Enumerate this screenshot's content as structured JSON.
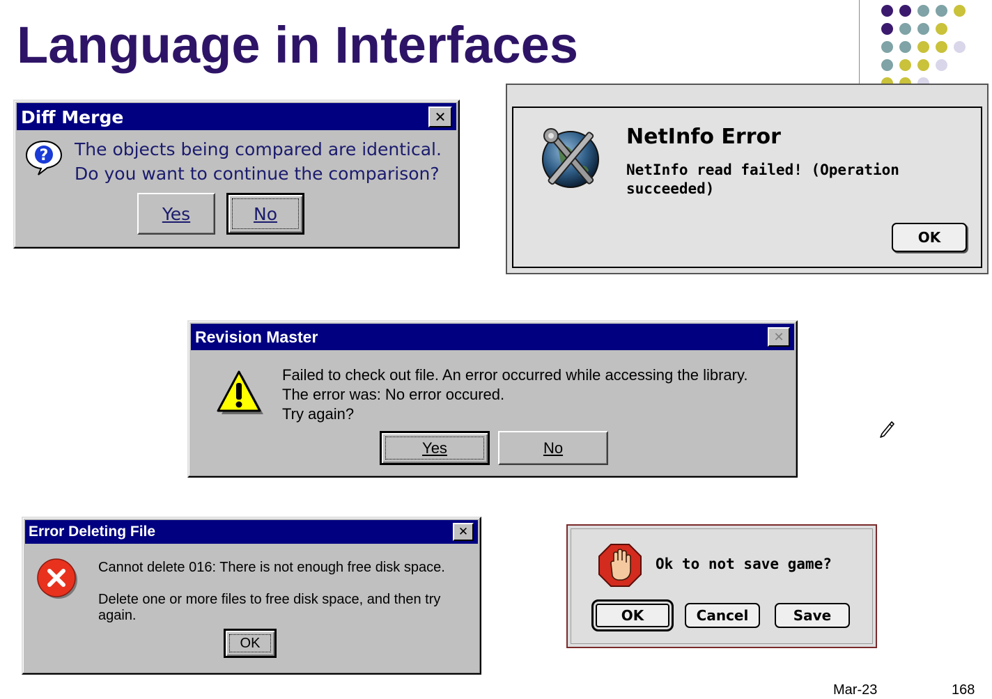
{
  "slide": {
    "title": "Language in Interfaces",
    "date": "Mar-23",
    "page": "168"
  },
  "diff_merge": {
    "title": "Diff  Merge",
    "message_line1": "The objects being compared are identical.",
    "message_line2": "Do you want to continue the comparison?",
    "yes_label": "Yes",
    "no_label": "No",
    "close_glyph": "✕"
  },
  "netinfo": {
    "title": "NetInfo Error",
    "message_line1": "NetInfo read failed! (Operation",
    "message_line2": "succeeded)",
    "ok_label": "OK"
  },
  "revision_master": {
    "title": "Revision Master",
    "message_line1": "Failed to check out file.  An error occurred while accessing the library.",
    "message_line2": "The error was:  No error occured.",
    "message_line3": "Try again?",
    "yes_label": "Yes",
    "no_label": "No",
    "close_glyph": "✕"
  },
  "error_deleting": {
    "title": "Error Deleting File",
    "message_line1": "Cannot delete 016: There is not enough free disk space.",
    "message_line2": "Delete one or more files to free disk space, and then try again.",
    "ok_label": "OK",
    "close_glyph": "✕"
  },
  "save_game": {
    "message": "Ok to not save game?",
    "ok_label": "OK",
    "cancel_label": "Cancel",
    "save_label": "Save"
  },
  "colors": {
    "title_purple": "#2e1466",
    "dot_purple": "#3b1a6e",
    "dot_teal": "#7fa3a6",
    "dot_olive": "#c9c23a",
    "dot_lavender": "#d9d6ea",
    "win_titlebar": "#000080"
  },
  "icons": {
    "diff_merge": "question-balloon-icon",
    "netinfo": "tools-globe-icon",
    "revision_master": "warning-triangle-icon",
    "error_deleting": "error-x-circle-icon",
    "save_game": "stop-hand-icon",
    "annotation": "pencil-icon"
  }
}
